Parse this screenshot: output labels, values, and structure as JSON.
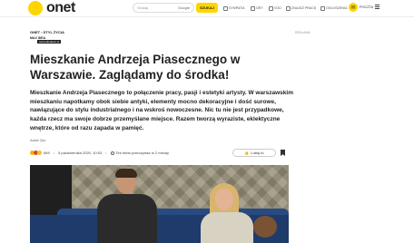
{
  "header": {
    "logo_text": "onet",
    "search_placeholder": "Szukaj",
    "search_engine_label": "Google",
    "search_button_label": "SZUKAJ",
    "nav_items": [
      {
        "label": "SYMPATIA",
        "icon": "heart-icon"
      },
      {
        "label": "GRY",
        "icon": "gamepad-icon"
      },
      {
        "label": "VOD",
        "icon": "play-icon"
      },
      {
        "label": "ZNAJDŹ PRACĘ",
        "icon": "briefcase-icon"
      },
      {
        "label": "OGŁOSZENIA",
        "icon": "tag-icon"
      }
    ],
    "mail_label": "POCZTA",
    "mail_icon": "envelope-icon",
    "accent_color": "#ffd500"
  },
  "article": {
    "breadcrumb": "ONET › STYL ŻYCIA",
    "source_logo": "MAX IDEA",
    "source_tag": "www.elledecor.pl",
    "title": "Mieszkanie Andrzeja Piasecznego w Warszawie. Zaglądamy do środka!",
    "lead": "Mieszkanie Andrzeja Piasecznego to połączenie pracy, pasji i estetyki artysty. W warszawskim mieszkaniu napotkamy obok siebie antyki, elementy mocno dekoracyjne i dość surowe, nawiązujące do stylu industrialnego i na wskroś nowoczesne. Nic tu nie jest przypadkowe, każda rzecz ma swoje dobrze przemyślane miejsce. Razem tworzą wyraziste, eklektyczne wnętrze, które od razu zapada w pamięć.",
    "author": "Adam Zys",
    "reactions_count": "669",
    "date": "5 października 2020, 10:53",
    "reading_time": "Ten tekst przeczytasz w 2 minuty",
    "like_label": "Lubię to"
  },
  "sidebar": {
    "ad_label": "REKLAMA"
  }
}
